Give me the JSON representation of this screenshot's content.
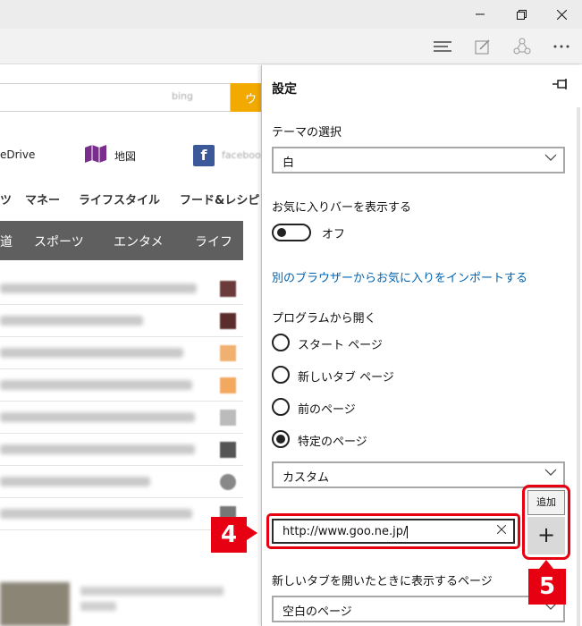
{
  "window": {
    "restore_icon": "restore-icon",
    "close_icon": "close-icon"
  },
  "toolbar": {
    "icons": [
      "hub-icon",
      "web-note-icon",
      "share-icon",
      "more-icon"
    ]
  },
  "page": {
    "bing_text": "bing",
    "search_button_label": "ウェ",
    "services": [
      "eDrive",
      "地図",
      "facebook"
    ],
    "categories": [
      "ツ",
      "マネー",
      "ライフスタイル",
      "フード&レシピ"
    ],
    "tabs": [
      "道",
      "スポーツ",
      "エンタメ",
      "ライフ"
    ]
  },
  "settings": {
    "title": "設定",
    "pin_icon": "pin-icon",
    "theme": {
      "label": "テーマの選択",
      "value": "白"
    },
    "favorites_bar": {
      "label": "お気に入りバーを表示する",
      "state": "オフ"
    },
    "import_link": "別のブラウザーからお気に入りをインポートする",
    "open_with": {
      "label": "プログラムから開く",
      "options": [
        "スタート ページ",
        "新しいタブ ページ",
        "前のページ",
        "特定のページ"
      ],
      "selected": "特定のページ"
    },
    "custom_select": "カスタム",
    "url_input": {
      "value": "http://www.goo.ne.jp/"
    },
    "add_tooltip": "追加",
    "add_button": "+",
    "new_tab": {
      "label": "新しいタブを開いたときに表示するページ",
      "value": "空白のページ"
    }
  },
  "annotations": {
    "step4": "4",
    "step5": "5",
    "color": "#e60012"
  }
}
